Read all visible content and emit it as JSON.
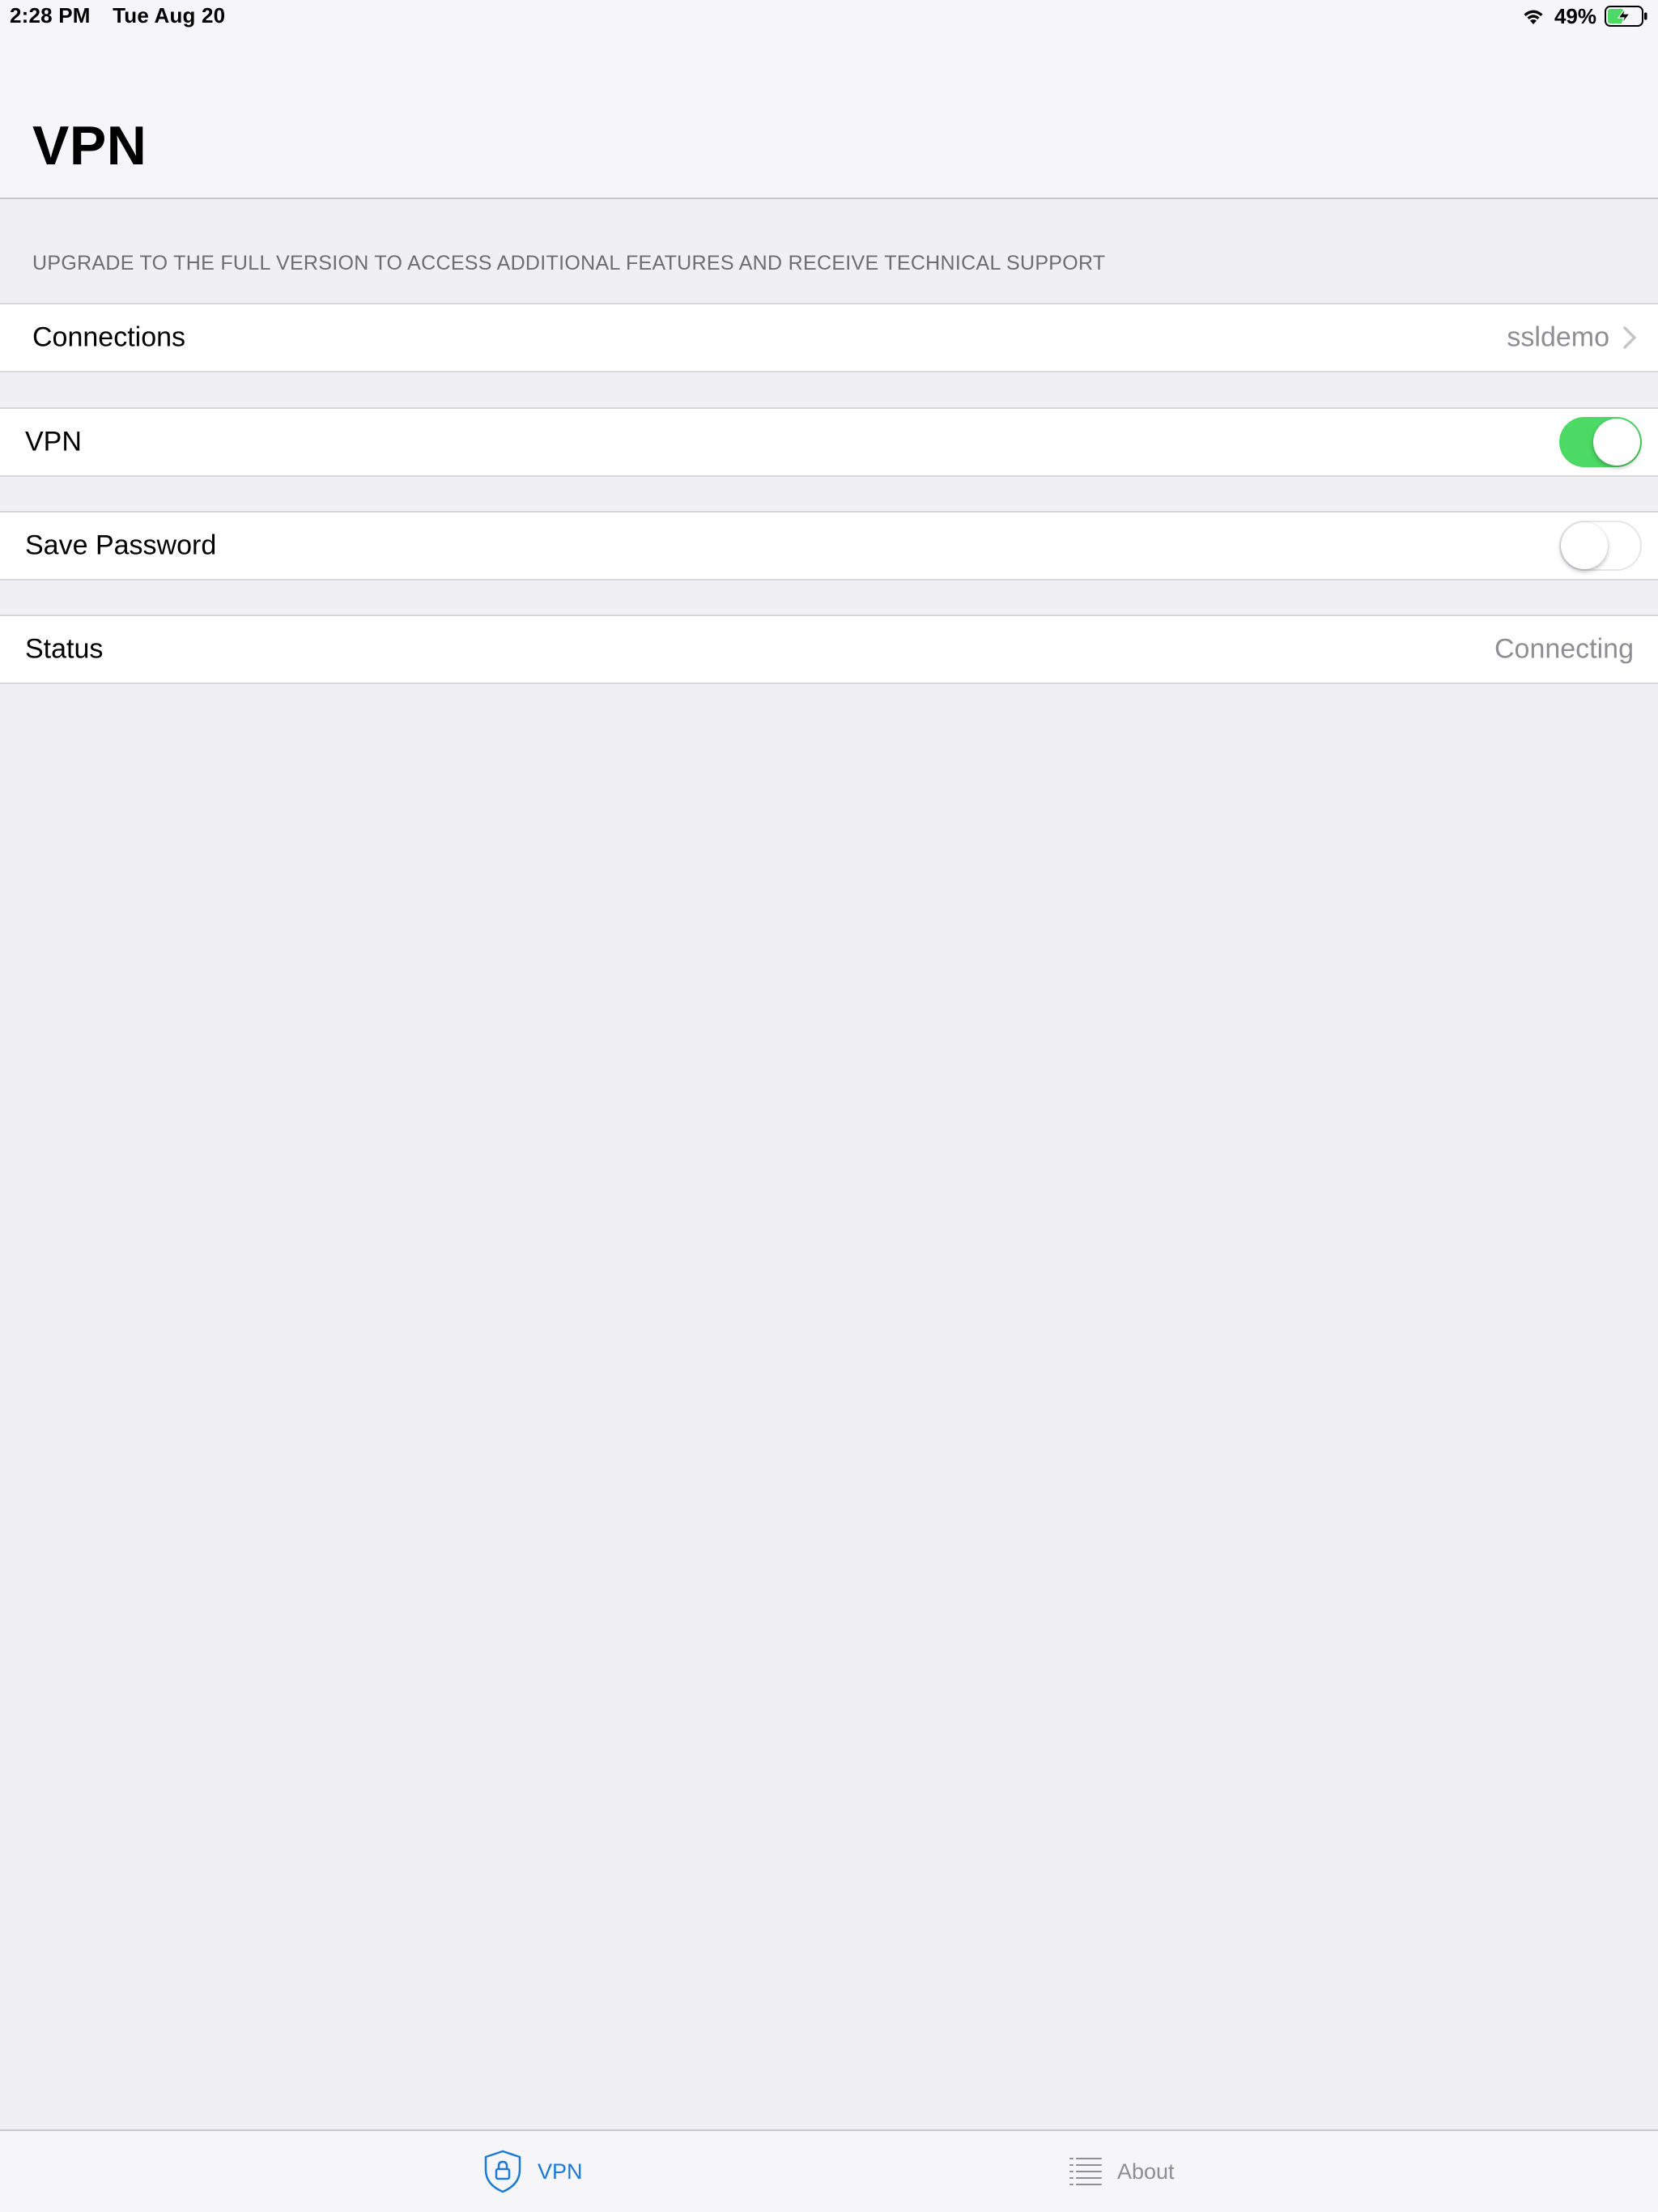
{
  "status_bar": {
    "time": "2:28 PM",
    "date": "Tue Aug 20",
    "battery_percent": "49%",
    "battery_level": 0.49,
    "charging": true
  },
  "nav": {
    "title": "VPN"
  },
  "upgrade_note": "UPGRADE TO THE FULL VERSION TO ACCESS ADDITIONAL FEATURES AND RECEIVE TECHNICAL SUPPORT",
  "rows": {
    "connections": {
      "label": "Connections",
      "value": "ssldemo"
    },
    "vpn": {
      "label": "VPN",
      "toggle_on": true
    },
    "save_password": {
      "label": "Save Password",
      "toggle_on": false
    },
    "status": {
      "label": "Status",
      "value": "Connecting"
    }
  },
  "tab_bar": {
    "tabs": [
      {
        "label": "VPN",
        "icon": "shield-lock-icon",
        "active": true
      },
      {
        "label": "About",
        "icon": "list-icon",
        "active": false
      }
    ]
  },
  "colors": {
    "accent": "#1b7ad6",
    "toggle_on": "#4cd964",
    "secondary_text": "#8e8e93",
    "background": "#efeff4"
  }
}
